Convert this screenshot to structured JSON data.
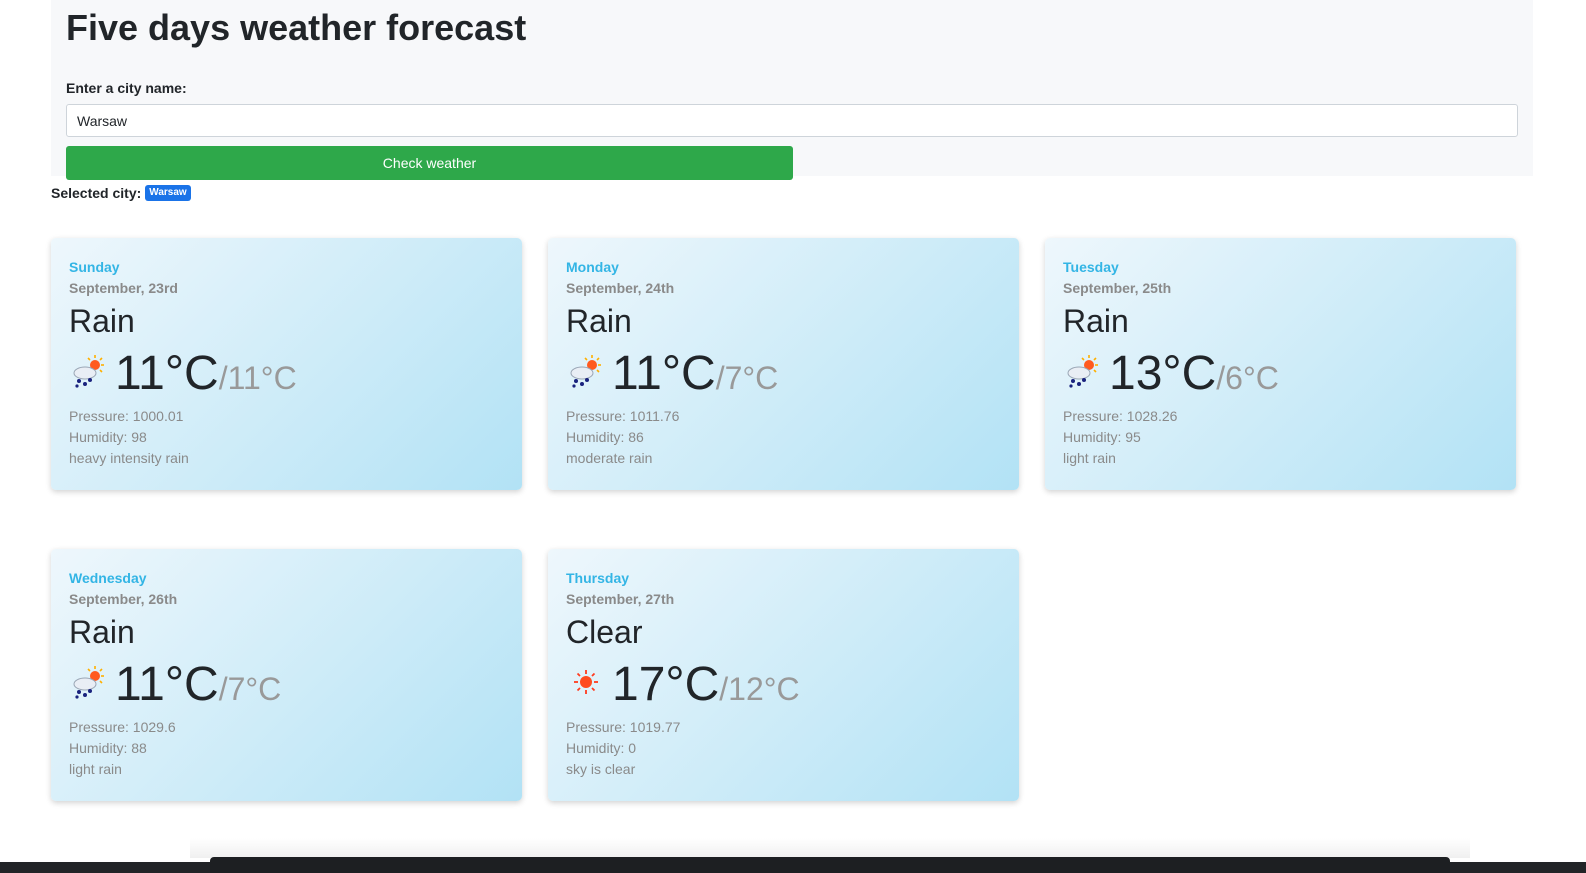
{
  "header": {
    "title": "Five days weather forecast"
  },
  "form": {
    "label": "Enter a city name:",
    "city_value": "Warsaw",
    "button_label": "Check weather"
  },
  "selected": {
    "label": "Selected city:",
    "city": "Warsaw"
  },
  "forecast": [
    {
      "day": "Sunday",
      "date": "September, 23rd",
      "main": "Rain",
      "icon": "rain-sun-icon",
      "temp_max": "11°C",
      "temp_min": "/11°C",
      "pressure": "Pressure: 1000.01",
      "humidity": "Humidity: 98",
      "description": "heavy intensity rain"
    },
    {
      "day": "Monday",
      "date": "September, 24th",
      "main": "Rain",
      "icon": "rain-sun-icon",
      "temp_max": "11°C",
      "temp_min": "/7°C",
      "pressure": "Pressure: 1011.76",
      "humidity": "Humidity: 86",
      "description": "moderate rain"
    },
    {
      "day": "Tuesday",
      "date": "September, 25th",
      "main": "Rain",
      "icon": "rain-sun-icon",
      "temp_max": "13°C",
      "temp_min": "/6°C",
      "pressure": "Pressure: 1028.26",
      "humidity": "Humidity: 95",
      "description": "light rain"
    },
    {
      "day": "Wednesday",
      "date": "September, 26th",
      "main": "Rain",
      "icon": "rain-sun-icon",
      "temp_max": "11°C",
      "temp_min": "/7°C",
      "pressure": "Pressure: 1029.6",
      "humidity": "Humidity: 88",
      "description": "light rain"
    },
    {
      "day": "Thursday",
      "date": "September, 27th",
      "main": "Clear",
      "icon": "sun-icon",
      "temp_max": "17°C",
      "temp_min": "/12°C",
      "pressure": "Pressure: 1019.77",
      "humidity": "Humidity: 0",
      "description": "sky is clear"
    }
  ],
  "colors": {
    "button": "#2ea84a",
    "badge": "#1a73e8",
    "day_label": "#33b5e5"
  }
}
